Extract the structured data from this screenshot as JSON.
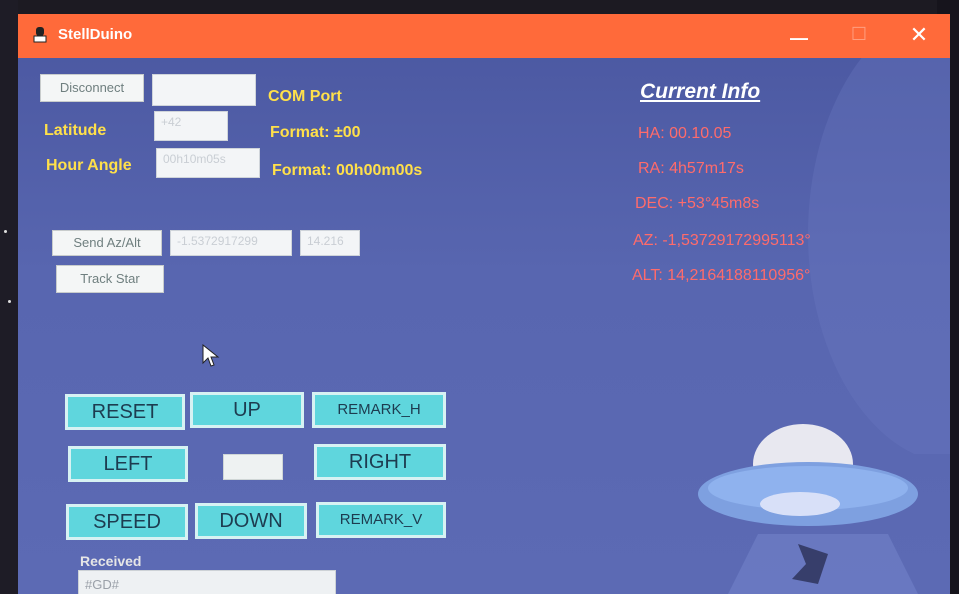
{
  "window": {
    "title": "StellDuino",
    "controls": {
      "minimize": "—",
      "maximize": "☐",
      "close": "✕"
    }
  },
  "connection": {
    "disconnect_label": "Disconnect",
    "com_value": "",
    "com_label": "COM Port"
  },
  "latitude": {
    "label": "Latitude",
    "value": "+42",
    "format": "Format: ±00"
  },
  "hour_angle": {
    "label": "Hour Angle",
    "value": "00h10m05s",
    "format": "Format: 00h00m00s"
  },
  "azalt": {
    "send_label": "Send Az/Alt",
    "az_value": "-1.5372917299",
    "alt_value": "14.216"
  },
  "track": {
    "label": "Track Star"
  },
  "info": {
    "title": "Current Info",
    "ha": "HA: 00.10.05",
    "ra": "RA: 4h57m17s",
    "dec": "DEC: +53°45m8s",
    "az": "AZ: -1,53729172995113°",
    "alt": "ALT: 14,2164188110956°",
    "color": "#ff6b6b"
  },
  "controls": {
    "reset": "RESET",
    "up": "UP",
    "remark_h": "REMARK_H",
    "left": "LEFT",
    "right": "RIGHT",
    "speed": "SPEED",
    "down": "DOWN",
    "remark_v": "REMARK_V"
  },
  "received": {
    "label": "Received",
    "value": "#GD#"
  },
  "colors": {
    "titlebar": "#ff6a3a",
    "label_yellow": "#ffe04a",
    "button_cyan": "#5fd6dd"
  },
  "icons": {
    "app": "telescope-icon",
    "cursor": "mouse-pointer-icon",
    "ufo": "ufo-icon"
  }
}
